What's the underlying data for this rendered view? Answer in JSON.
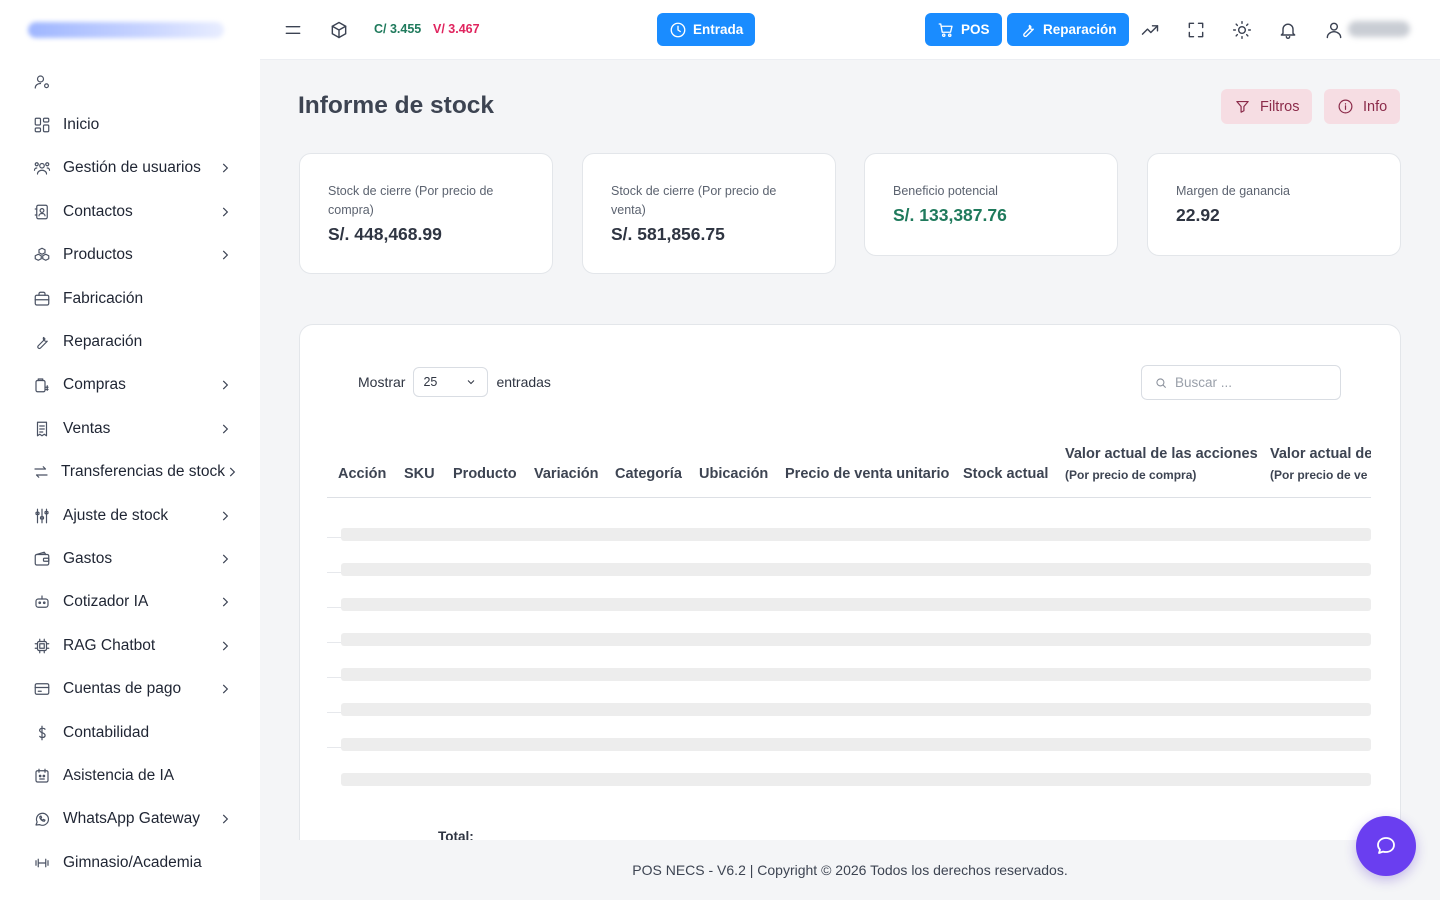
{
  "sidebar": {
    "items": [
      {
        "label": "",
        "icon": "user-settings-icon",
        "chevron": false
      },
      {
        "label": "Inicio",
        "icon": "dashboard-icon",
        "chevron": false
      },
      {
        "label": "Gestión de usuarios",
        "icon": "users-icon",
        "chevron": true
      },
      {
        "label": "Contactos",
        "icon": "contacts-icon",
        "chevron": true
      },
      {
        "label": "Productos",
        "icon": "boxes-icon",
        "chevron": true
      },
      {
        "label": "Fabricación",
        "icon": "briefcase-icon",
        "chevron": false
      },
      {
        "label": "Reparación",
        "icon": "wrench-icon",
        "chevron": false
      },
      {
        "label": "Compras",
        "icon": "purchase-icon",
        "chevron": true
      },
      {
        "label": "Ventas",
        "icon": "receipt-icon",
        "chevron": true
      },
      {
        "label": "Transferencias de stock",
        "icon": "transfer-icon",
        "chevron": true
      },
      {
        "label": "Ajuste de stock",
        "icon": "sliders-icon",
        "chevron": true
      },
      {
        "label": "Gastos",
        "icon": "wallet-icon",
        "chevron": true
      },
      {
        "label": "Cotizador IA",
        "icon": "robot-icon",
        "chevron": true
      },
      {
        "label": "RAG Chatbot",
        "icon": "chip-icon",
        "chevron": true
      },
      {
        "label": "Cuentas de pago",
        "icon": "card-icon",
        "chevron": true
      },
      {
        "label": "Contabilidad",
        "icon": "dollar-icon",
        "chevron": false
      },
      {
        "label": "Asistencia de IA",
        "icon": "assistant-icon",
        "chevron": false
      },
      {
        "label": "WhatsApp Gateway",
        "icon": "whatsapp-icon",
        "chevron": true
      },
      {
        "label": "Gimnasio/Academia",
        "icon": "dumbbell-icon",
        "chevron": false
      }
    ]
  },
  "topbar": {
    "rate_buy": "C/ 3.455",
    "rate_sell": "V/ 3.467",
    "entrada_label": "Entrada",
    "pos_label": "POS",
    "reparacion_label": "Reparación"
  },
  "page": {
    "title": "Informe de stock",
    "filters_label": "Filtros",
    "info_label": "Info"
  },
  "cards": [
    {
      "label": "Stock de cierre (Por precio de compra)",
      "value": "S/. 448,468.99"
    },
    {
      "label": "Stock de cierre (Por precio de venta)",
      "value": "S/. 581,856.75"
    },
    {
      "label": "Beneficio potencial",
      "value": "S/. 133,387.76"
    },
    {
      "label": "Margen de ganancia",
      "value": "22.92"
    }
  ],
  "table": {
    "show_label": "Mostrar",
    "page_size": "25",
    "entries_label": "entradas",
    "search_placeholder": "Buscar ...",
    "columns": [
      {
        "title": "Acción",
        "sub": ""
      },
      {
        "title": "SKU",
        "sub": ""
      },
      {
        "title": "Producto",
        "sub": ""
      },
      {
        "title": "Variación",
        "sub": ""
      },
      {
        "title": "Categoría",
        "sub": ""
      },
      {
        "title": "Ubicación",
        "sub": ""
      },
      {
        "title": "Precio de venta unitario",
        "sub": ""
      },
      {
        "title": "Stock actual",
        "sub": ""
      },
      {
        "title": "Valor actual de las acciones",
        "sub": "(Por precio de compra)"
      },
      {
        "title": "Valor actual de",
        "sub": "(Por precio de ve"
      }
    ],
    "total_label": "Total:"
  },
  "footer": {
    "text": "POS NECS - V6.2 | Copyright © 2026 Todos los derechos reservados."
  },
  "colors": {
    "accent": "#1a8cff",
    "rate_buy": "#1f7a5c",
    "rate_sell": "#e0245e",
    "chip_bg": "#f6dde3",
    "chat_fab": "#6a3ef0"
  }
}
